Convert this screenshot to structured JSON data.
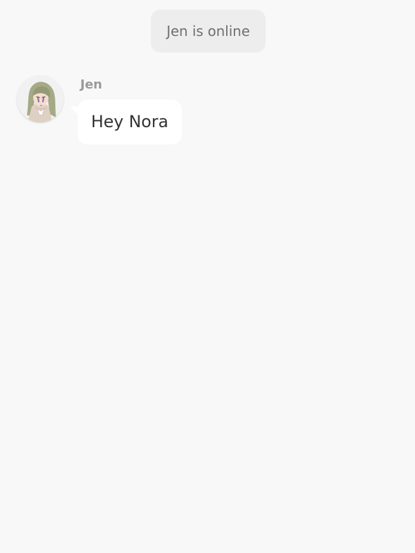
{
  "chat": {
    "system_notice": "Jen is online",
    "messages": [
      {
        "sender": "Jen",
        "text": "Hey Nora",
        "avatar_icon": "character-avatar-icon"
      }
    ]
  },
  "colors": {
    "background": "#f8f8f8",
    "notice_background": "#ededed",
    "notice_text": "#6f6f6f",
    "sender_name": "#9a9a9a",
    "bubble_background": "#ffffff",
    "bubble_text": "#333333"
  }
}
